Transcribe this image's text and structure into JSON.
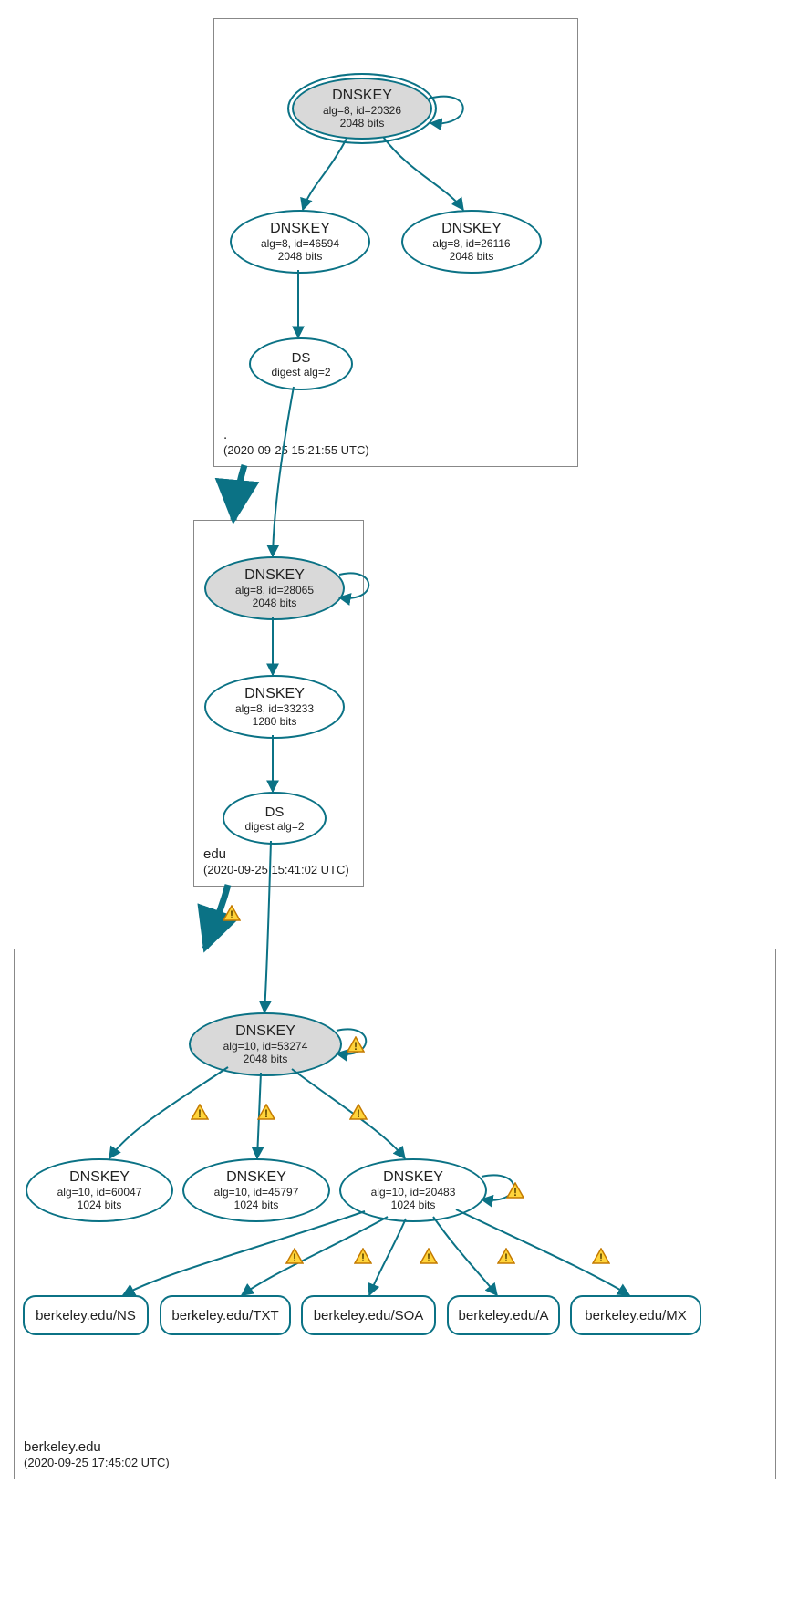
{
  "colors": {
    "stroke": "#0b7285",
    "ksk_fill": "#d9d9d9",
    "warn_fill": "#ffd43b",
    "warn_stroke": "#c47a00"
  },
  "zones": {
    "root": {
      "name": ".",
      "timestamp": "(2020-09-25 15:21:55 UTC)"
    },
    "edu": {
      "name": "edu",
      "timestamp": "(2020-09-25 15:41:02 UTC)"
    },
    "berkeley": {
      "name": "berkeley.edu",
      "timestamp": "(2020-09-25 17:45:02 UTC)"
    }
  },
  "nodes": {
    "root_ksk": {
      "title": "DNSKEY",
      "sub1": "alg=8, id=20326",
      "sub2": "2048 bits"
    },
    "root_zsk1": {
      "title": "DNSKEY",
      "sub1": "alg=8, id=46594",
      "sub2": "2048 bits"
    },
    "root_zsk2": {
      "title": "DNSKEY",
      "sub1": "alg=8, id=26116",
      "sub2": "2048 bits"
    },
    "root_ds": {
      "title": "DS",
      "sub1": "digest alg=2"
    },
    "edu_ksk": {
      "title": "DNSKEY",
      "sub1": "alg=8, id=28065",
      "sub2": "2048 bits"
    },
    "edu_zsk": {
      "title": "DNSKEY",
      "sub1": "alg=8, id=33233",
      "sub2": "1280 bits"
    },
    "edu_ds": {
      "title": "DS",
      "sub1": "digest alg=2"
    },
    "bk_ksk": {
      "title": "DNSKEY",
      "sub1": "alg=10, id=53274",
      "sub2": "2048 bits"
    },
    "bk_zsk1": {
      "title": "DNSKEY",
      "sub1": "alg=10, id=60047",
      "sub2": "1024 bits"
    },
    "bk_zsk2": {
      "title": "DNSKEY",
      "sub1": "alg=10, id=45797",
      "sub2": "1024 bits"
    },
    "bk_zsk3": {
      "title": "DNSKEY",
      "sub1": "alg=10, id=20483",
      "sub2": "1024 bits"
    },
    "rr_ns": {
      "label": "berkeley.edu/NS"
    },
    "rr_txt": {
      "label": "berkeley.edu/TXT"
    },
    "rr_soa": {
      "label": "berkeley.edu/SOA"
    },
    "rr_a": {
      "label": "berkeley.edu/A"
    },
    "rr_mx": {
      "label": "berkeley.edu/MX"
    }
  }
}
